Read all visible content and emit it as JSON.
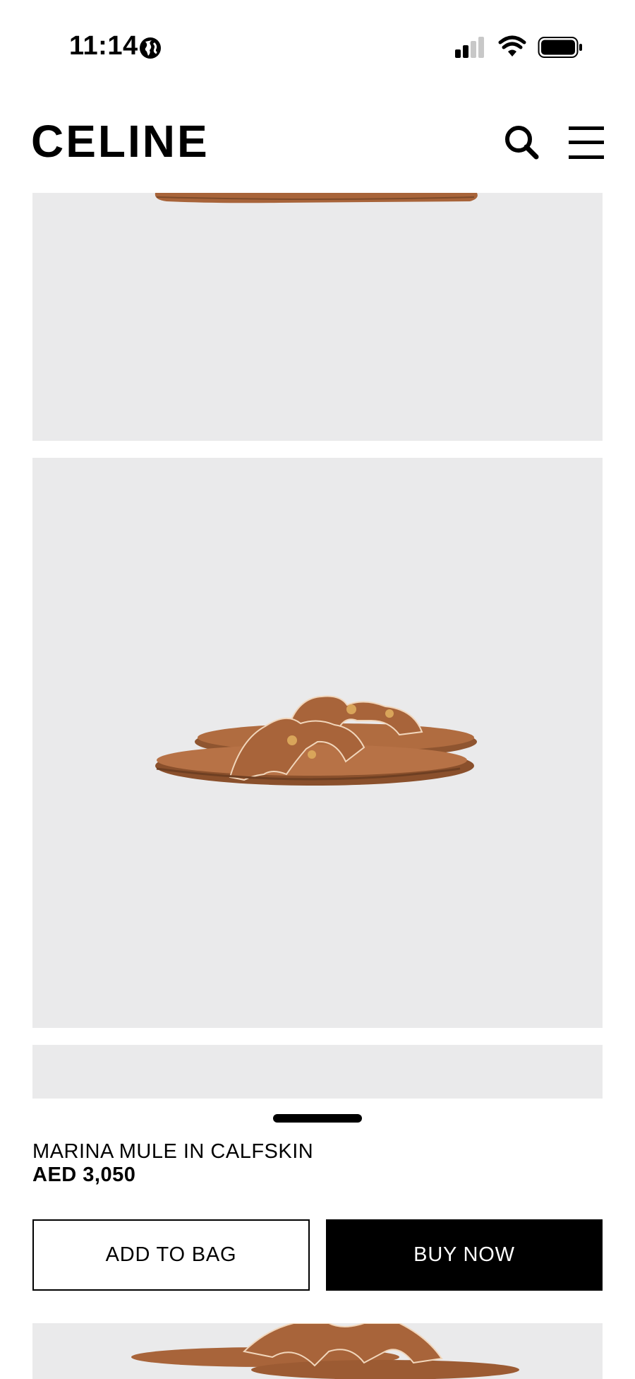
{
  "status_bar": {
    "time": "11:14",
    "icons": [
      "globe-icon",
      "signal-icon",
      "wifi-icon",
      "battery-icon"
    ]
  },
  "header": {
    "logo": "CELINE",
    "icons": [
      "search-icon",
      "hamburger-menu-icon"
    ]
  },
  "gallery": {
    "background_color": "#eaeaeb",
    "images": [
      "marina-mule-side-view",
      "marina-mule-pair-angle",
      "marina-mule-blank",
      "marina-mule-pair-front"
    ]
  },
  "product": {
    "name": "MARINA MULE IN CALFSKIN",
    "price": "AED 3,050"
  },
  "actions": {
    "add_to_bag": "ADD TO BAG",
    "buy_now": "BUY NOW"
  },
  "colors": {
    "leather": "#a8643a",
    "text": "#000000",
    "panel": "#eaeaeb"
  }
}
